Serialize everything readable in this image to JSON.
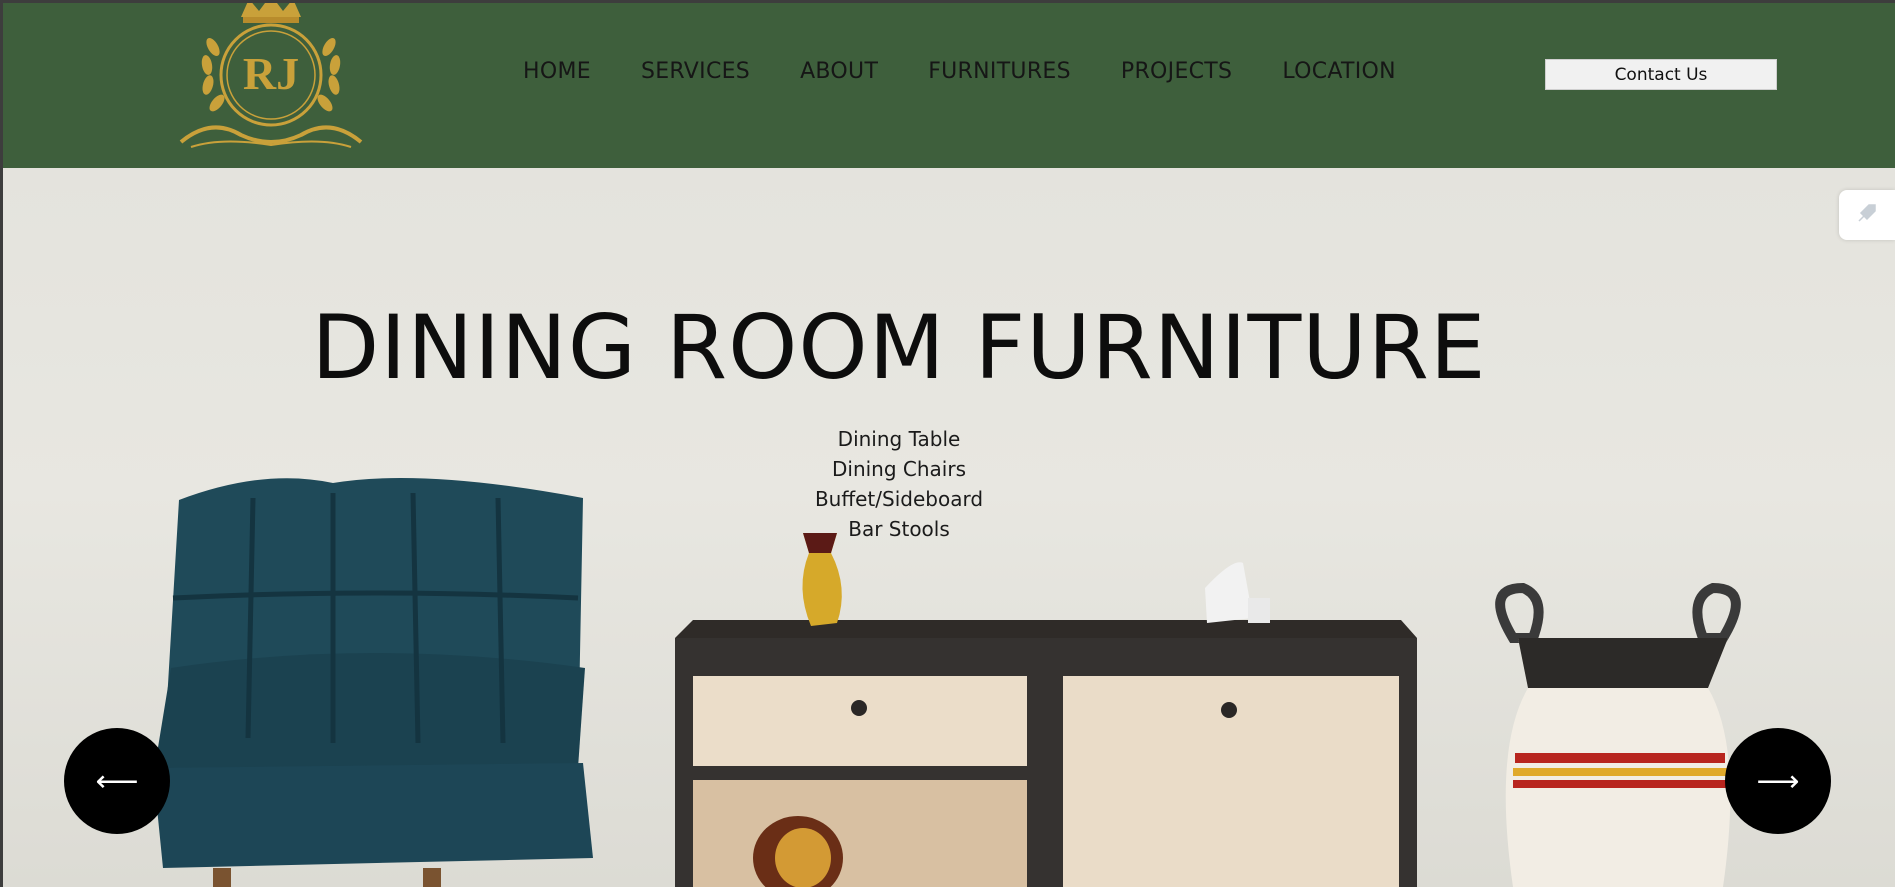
{
  "brand": {
    "logo_text": "RJ",
    "gold": "#c9a13a"
  },
  "header": {
    "background": "#3e5f3c"
  },
  "nav": {
    "items": [
      {
        "label": "HOME"
      },
      {
        "label": "SERVICES"
      },
      {
        "label": "ABOUT"
      },
      {
        "label": "FURNITURES"
      },
      {
        "label": "PROJECTS"
      },
      {
        "label": "LOCATION"
      }
    ],
    "contact_label": "Contact Us"
  },
  "hero": {
    "title": "DINING ROOM FURNITURE",
    "items": [
      "Dining Table",
      "Dining Chairs",
      "Buffet/Sideboard",
      "Bar Stools"
    ],
    "prev_icon": "arrow-left-icon",
    "next_icon": "arrow-right-icon",
    "prev_glyph": "⟵",
    "next_glyph": "⟶"
  },
  "side_tab": {
    "icon": "rocket-icon"
  }
}
